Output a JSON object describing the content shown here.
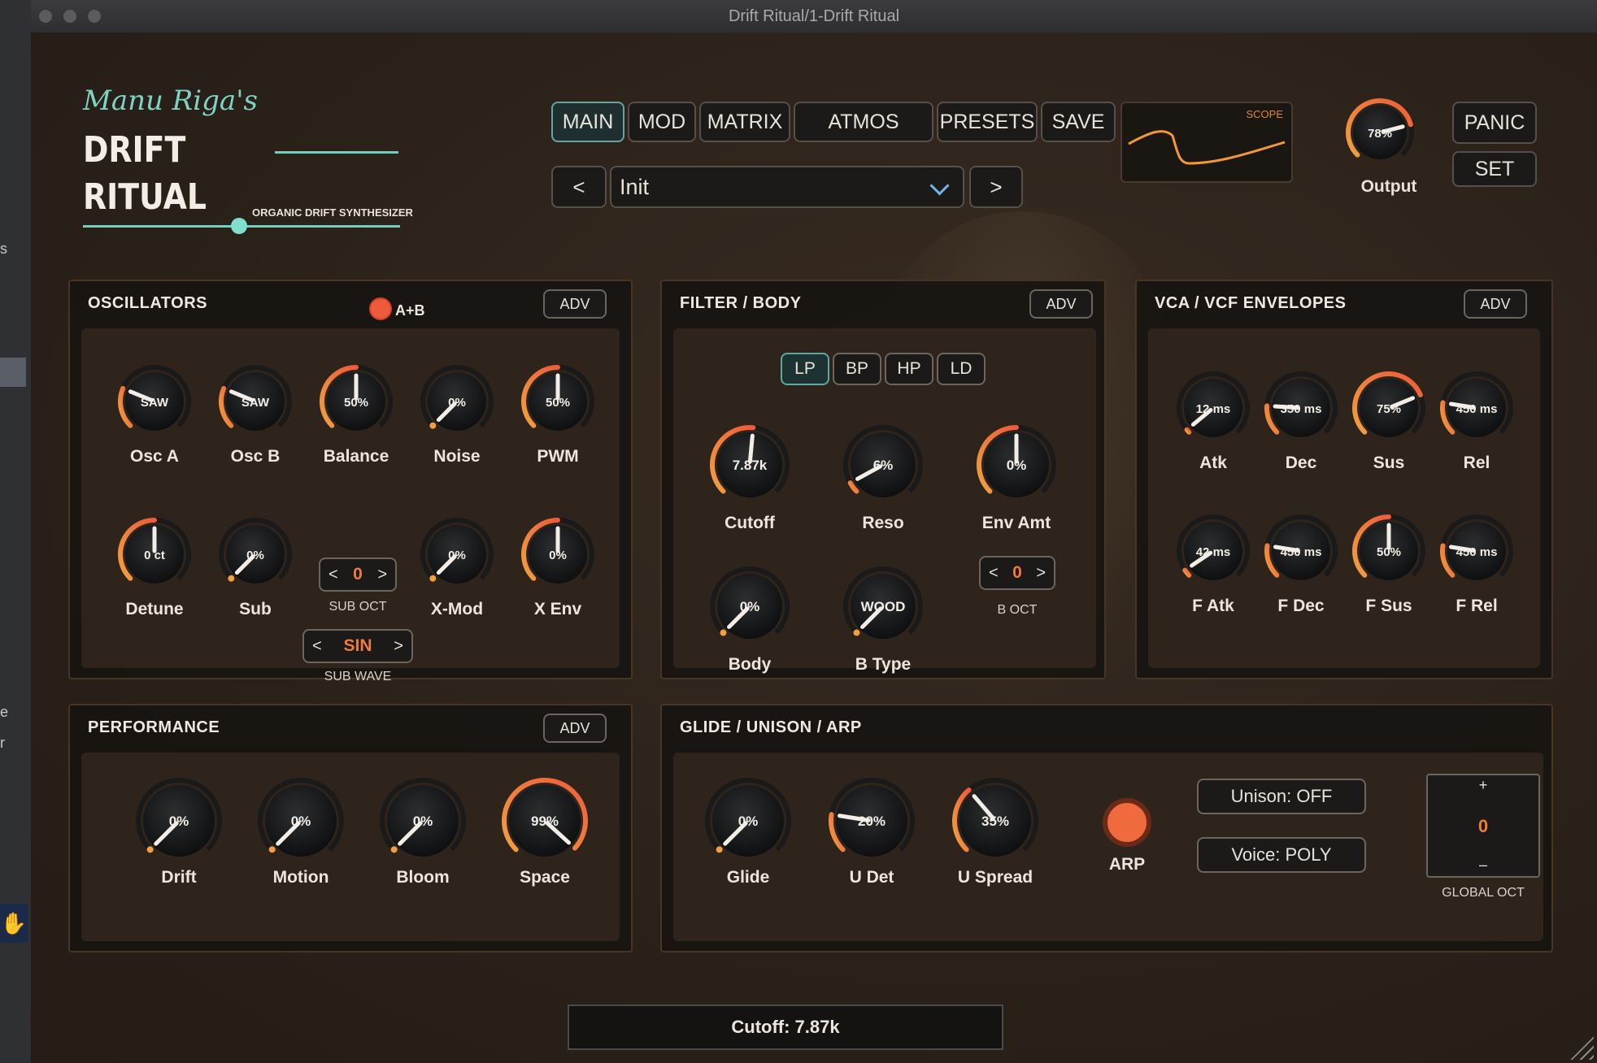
{
  "window": {
    "title": "Drift Ritual/1-Drift Ritual"
  },
  "backdrop": {
    "frag1": "s",
    "frag2": "e",
    "frag3": "r"
  },
  "brand": {
    "script": "Manu Riga's",
    "line1": "DRIFT",
    "line2": "RITUAL",
    "tagline": "ORGANIC DRIFT SYNTHESIZER"
  },
  "nav": {
    "main": "MAIN",
    "mod": "MOD",
    "matrix": "MATRIX",
    "atmos": "ATMOS",
    "presets": "PRESETS",
    "save": "SAVE"
  },
  "preset": {
    "prev": "<",
    "name": "Init",
    "next": ">"
  },
  "scope": {
    "label": "SCOPE"
  },
  "output": {
    "value": "78%",
    "label": "Output",
    "level": 0.78
  },
  "side": {
    "panic": "PANIC",
    "set": "SET"
  },
  "colors": {
    "accent_orange": "#f07a3a",
    "accent_teal": "#6fd0c0",
    "panel_bg": "#181411"
  },
  "oscillators": {
    "title": "OSCILLATORS",
    "ab_label": "A+B",
    "adv": "ADV",
    "knobs": [
      {
        "label": "Osc A",
        "value": "SAW",
        "level": 0.25
      },
      {
        "label": "Osc B",
        "value": "SAW",
        "level": 0.25
      },
      {
        "label": "Balance",
        "value": "50%",
        "level": 0.5
      },
      {
        "label": "Noise",
        "value": "0%",
        "level": 0
      },
      {
        "label": "PWM",
        "value": "50%",
        "level": 0.5
      },
      {
        "label": "Detune",
        "value": "0 ct",
        "level": 0.5
      },
      {
        "label": "Sub",
        "value": "0%",
        "level": 0
      },
      {
        "label": "X-Mod",
        "value": "0%",
        "level": 0
      },
      {
        "label": "X Env",
        "value": "0%",
        "level": 0.5
      }
    ],
    "sub_oct": {
      "value": "0",
      "label": "SUB OCT",
      "dec": "<",
      "inc": ">"
    },
    "sub_wave": {
      "value": "SIN",
      "label": "SUB WAVE",
      "dec": "<",
      "inc": ">"
    }
  },
  "filter": {
    "title": "FILTER / BODY",
    "adv": "ADV",
    "types": [
      "LP",
      "BP",
      "HP",
      "LD"
    ],
    "active_type": "LP",
    "knobs": [
      {
        "label": "Cutoff",
        "value": "7.87k",
        "level": 0.52
      },
      {
        "label": "Reso",
        "value": "6%",
        "level": 0.06
      },
      {
        "label": "Env Amt",
        "value": "0%",
        "level": 0.5
      },
      {
        "label": "Body",
        "value": "0%",
        "level": 0
      },
      {
        "label": "B Type",
        "value": "WOOD",
        "level": 0
      }
    ],
    "b_oct": {
      "value": "0",
      "label": "B OCT",
      "dec": "<",
      "inc": ">"
    }
  },
  "envelopes": {
    "title": "VCA / VCF ENVELOPES",
    "adv": "ADV",
    "knobs": [
      {
        "label": "Atk",
        "value": "12 ms",
        "level": 0.02
      },
      {
        "label": "Dec",
        "value": "350 ms",
        "level": 0.18
      },
      {
        "label": "Sus",
        "value": "75%",
        "level": 0.75
      },
      {
        "label": "Rel",
        "value": "450 ms",
        "level": 0.2
      },
      {
        "label": "F Atk",
        "value": "42 ms",
        "level": 0.04
      },
      {
        "label": "F Dec",
        "value": "450 ms",
        "level": 0.2
      },
      {
        "label": "F Sus",
        "value": "50%",
        "level": 0.5
      },
      {
        "label": "F Rel",
        "value": "450 ms",
        "level": 0.2
      }
    ]
  },
  "performance": {
    "title": "PERFORMANCE",
    "adv": "ADV",
    "knobs": [
      {
        "label": "Drift",
        "value": "0%",
        "level": 0
      },
      {
        "label": "Motion",
        "value": "0%",
        "level": 0
      },
      {
        "label": "Bloom",
        "value": "0%",
        "level": 0
      },
      {
        "label": "Space",
        "value": "99%",
        "level": 0.99
      }
    ]
  },
  "glide": {
    "title": "GLIDE / UNISON / ARP",
    "knobs": [
      {
        "label": "Glide",
        "value": "0%",
        "level": 0
      },
      {
        "label": "U Det",
        "value": "20%",
        "level": 0.2
      },
      {
        "label": "U Spread",
        "value": "35%",
        "level": 0.35
      }
    ],
    "arp": "ARP",
    "unison": "Unison: OFF",
    "voice": "Voice: POLY",
    "global_oct": {
      "plus": "+",
      "value": "0",
      "minus": "–",
      "label": "GLOBAL OCT"
    }
  },
  "status": {
    "text": "Cutoff: 7.87k"
  }
}
